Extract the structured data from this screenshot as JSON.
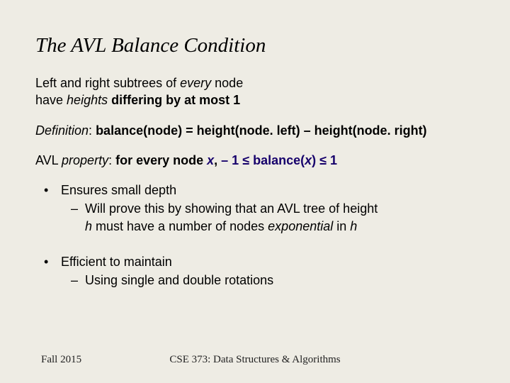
{
  "title": "The AVL Balance Condition",
  "para1_a": "Left and right subtrees of ",
  "para1_b": "every",
  "para1_c": " node",
  "para1_d": "have ",
  "para1_e": "heights",
  "para1_f": " differing by at most 1",
  "def_label": "Definition",
  "def_sep": ":  ",
  "def_body": "balance(node) = height(node. left) – height(node. right)",
  "prop_prefix": "AVL ",
  "prop_word": "property",
  "prop_sep": ":   ",
  "prop_head": "for every node ",
  "prop_x1": "x",
  "prop_comma": ",   ",
  "prop_neg1": "– 1 ",
  "prop_le1": "≤",
  "prop_bal_l": " balance(",
  "prop_x2": "x",
  "prop_bal_r": ") ",
  "prop_le2": "≤",
  "prop_one": " 1",
  "b1": "Ensures small depth",
  "b1s_a": "Will prove this by showing that an AVL tree of height",
  "b1s_b1": "h",
  "b1s_b2": " must have a number of nodes ",
  "b1s_b3": "exponential",
  "b1s_b4": " in ",
  "b1s_b5": "h",
  "b2": "Efficient to maintain",
  "b2s": "Using single and double rotations",
  "footer_left": "Fall 2015",
  "footer_center": "CSE 373: Data Structures & Algorithms"
}
